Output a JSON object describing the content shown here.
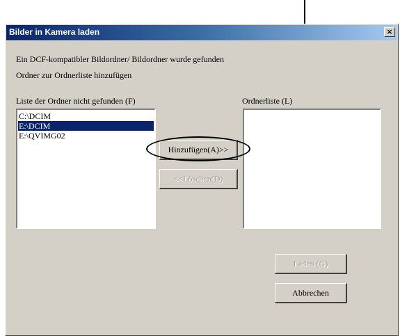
{
  "window": {
    "title": "Bilder in Kamera laden",
    "close_glyph": "×"
  },
  "info": {
    "line1": "Ein DCF-kompatibler Bildordner/ Bildordner wurde gefunden",
    "line2": "Ordner zur Ordnerliste hinzufügen"
  },
  "left_list": {
    "label": "Liste der Ordner nicht gefunden (F)",
    "items": [
      "C:\\DCIM",
      "E:\\DCIM",
      "E:\\QVIMG02"
    ],
    "selected_index": 1
  },
  "right_list": {
    "label": "Ordnerliste (L)",
    "items": []
  },
  "buttons": {
    "add": "Hinzufügen(A)>>",
    "delete": "<<Löschen(D)",
    "load": "Laden (G)",
    "cancel": "Abbrechen"
  },
  "colors": {
    "selection": "#0a246a",
    "dialog_bg": "#d4d0c8",
    "title_start": "#0a246a"
  }
}
